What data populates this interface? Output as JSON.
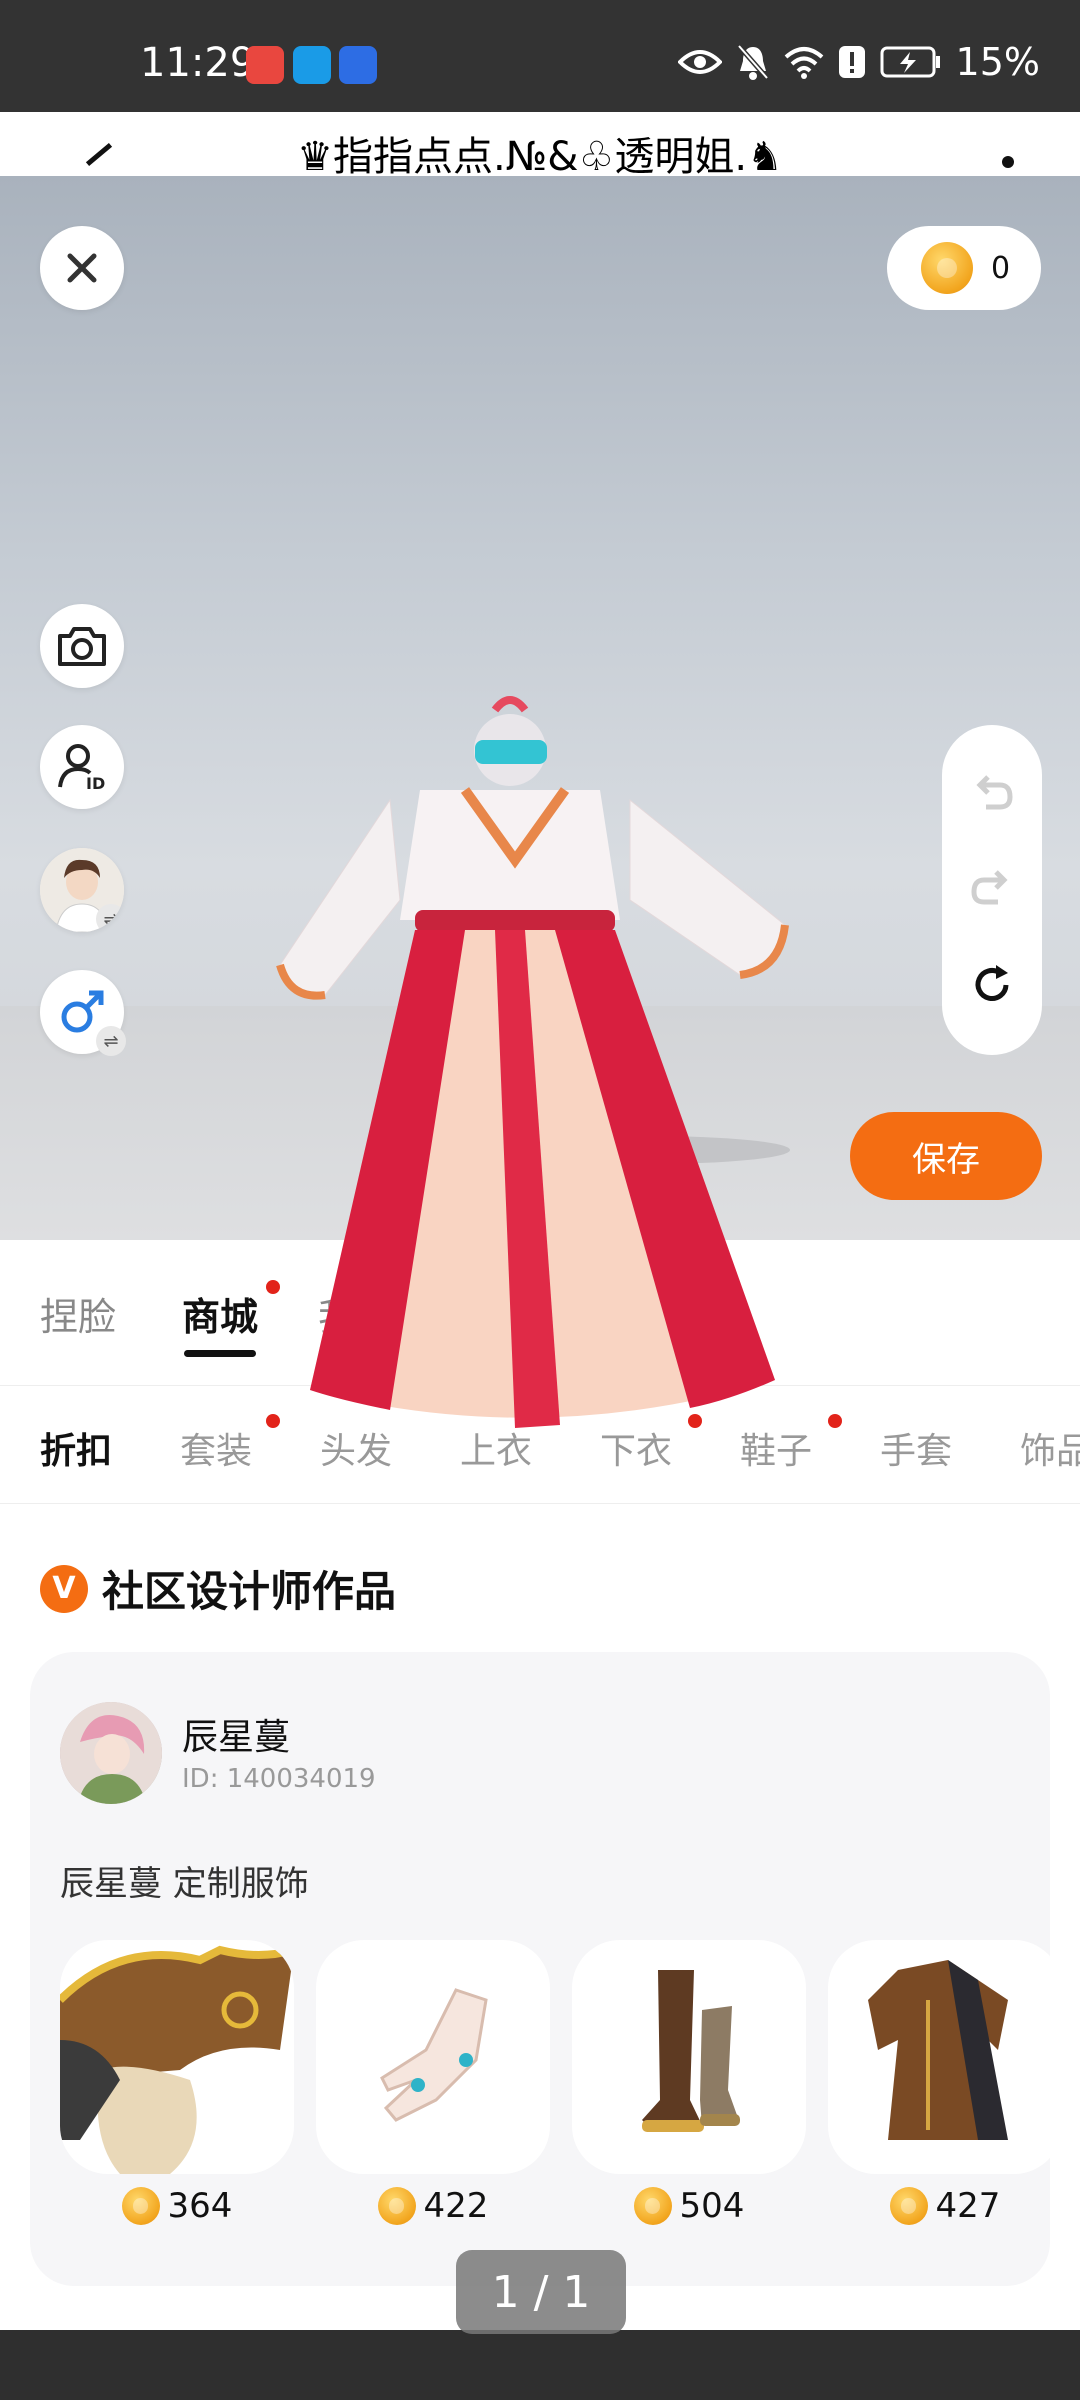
{
  "status_bar": {
    "time": "11:29",
    "battery": "15%",
    "icons": [
      "eye-icon",
      "bell-off-icon",
      "wifi-icon",
      "alert-icon",
      "battery-charging-icon"
    ]
  },
  "header": {
    "title": "♛指指点点.№&♧透明姐.♞"
  },
  "wallet": {
    "coins": "0"
  },
  "side_buttons": [
    "camera-icon",
    "id-icon",
    "avatar",
    "male-icon"
  ],
  "history": [
    "undo-icon",
    "redo-icon",
    "refresh-icon"
  ],
  "save_label": "保存",
  "main_tabs": [
    {
      "label": "捏脸",
      "active": false,
      "dot": false
    },
    {
      "label": "商城",
      "active": true,
      "dot": true
    },
    {
      "label": "我",
      "active": false,
      "dot": false
    }
  ],
  "sub_tabs": [
    {
      "label": "折扣",
      "active": true,
      "dot": false
    },
    {
      "label": "套装",
      "active": false,
      "dot": true
    },
    {
      "label": "头发",
      "active": false,
      "dot": false
    },
    {
      "label": "上衣",
      "active": false,
      "dot": false
    },
    {
      "label": "下衣",
      "active": false,
      "dot": true
    },
    {
      "label": "鞋子",
      "active": false,
      "dot": true
    },
    {
      "label": "手套",
      "active": false,
      "dot": false
    },
    {
      "label": "饰品",
      "active": false,
      "dot": false
    }
  ],
  "section": {
    "badge": "V",
    "title": "社区设计师作品"
  },
  "designer": {
    "name": "辰星蔓",
    "id": "ID: 140034019",
    "description": "辰星蔓 定制服饰",
    "items": [
      {
        "name": "pirate-hat",
        "price": "364"
      },
      {
        "name": "ring-hand",
        "price": "422"
      },
      {
        "name": "boots",
        "price": "504"
      },
      {
        "name": "coat",
        "price": "427"
      }
    ]
  },
  "pager": "1 / 1",
  "colors": {
    "accent": "#f46d12",
    "dot": "#e2231a",
    "coin": "#f2a51e"
  }
}
